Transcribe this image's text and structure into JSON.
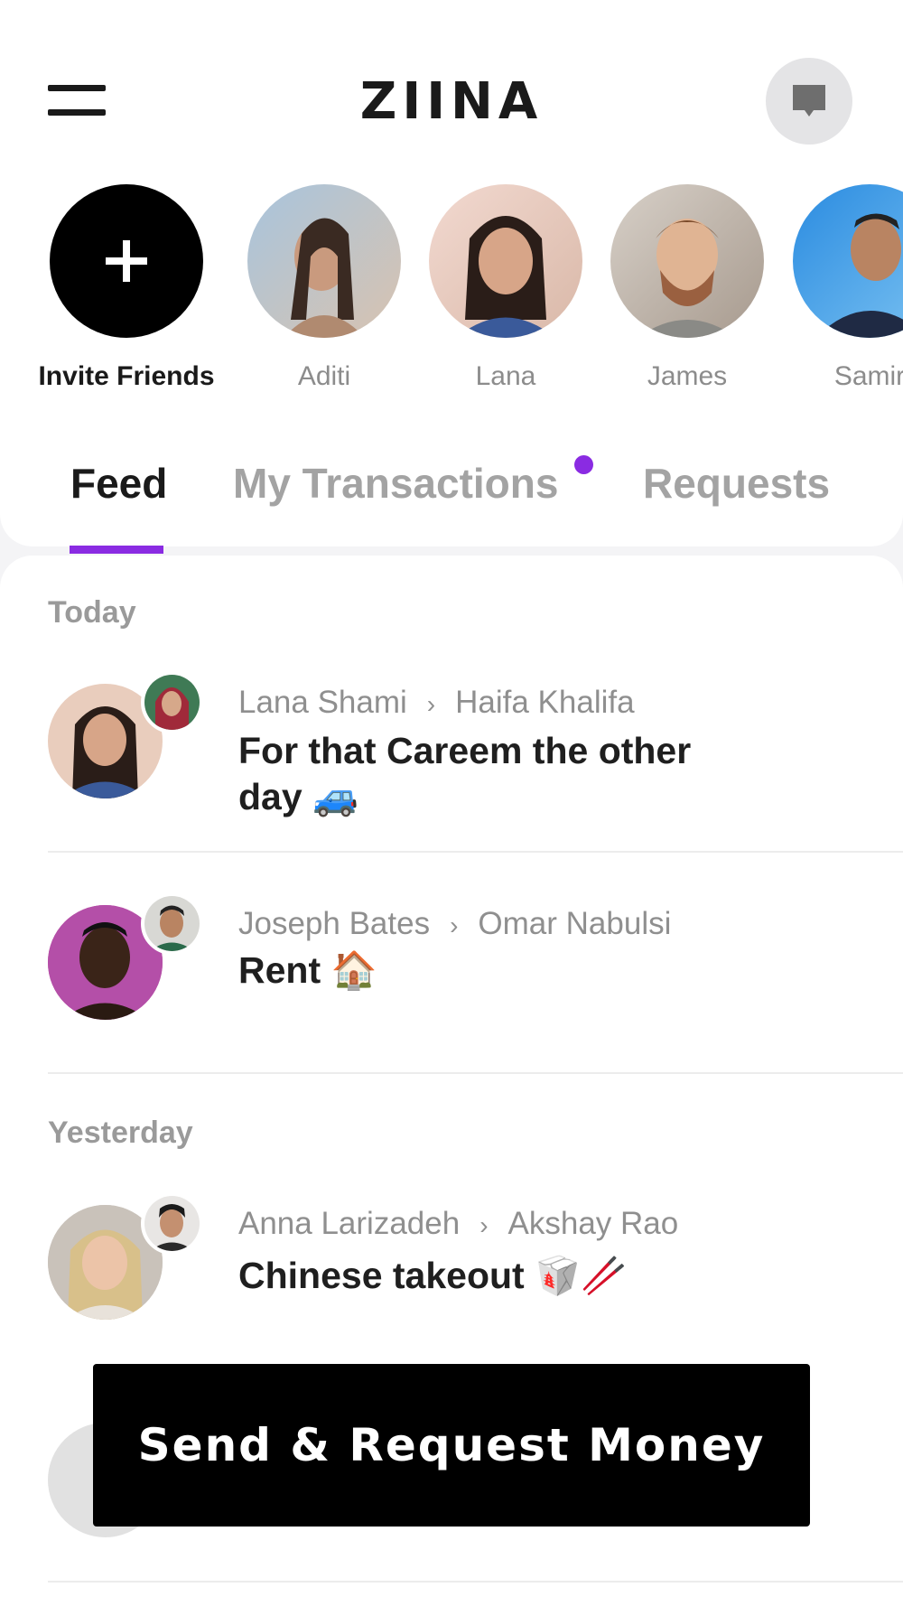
{
  "header": {
    "logo": "ZIINA",
    "menu_icon": "hamburger-menu-icon",
    "chat_icon": "chat-bubble-icon"
  },
  "stories": {
    "invite_label": "Invite Friends",
    "invite_icon": "plus-icon",
    "friends": [
      "Aditi",
      "Lana",
      "James",
      "Samir"
    ]
  },
  "tabs": {
    "feed": "Feed",
    "my_transactions": "My Transactions",
    "requests": "Requests",
    "accent_color": "#8a2be2"
  },
  "feed": {
    "sections": [
      {
        "label": "Today",
        "items": [
          {
            "from": "Lana Shami",
            "to": "Haifa Khalifa",
            "note": "For that Careem the other day 🚙"
          },
          {
            "from": "Joseph Bates",
            "to": "Omar Nabulsi",
            "note": "Rent 🏠"
          }
        ]
      },
      {
        "label": "Yesterday",
        "items": [
          {
            "from": "Anna Larizadeh",
            "to": "Akshay Rao",
            "note": "Chinese takeout 🥡🥢"
          }
        ]
      }
    ]
  },
  "cta": {
    "label": "Send & Request Money"
  }
}
